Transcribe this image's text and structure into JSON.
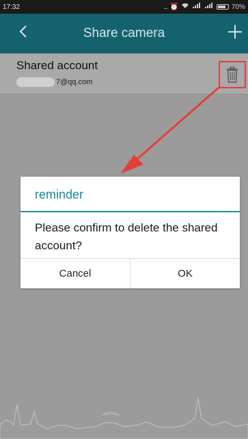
{
  "status_bar": {
    "time": "17:32",
    "signal_glyphs": "... ",
    "battery_percent": "70%"
  },
  "app_bar": {
    "back_icon": "chevron-left-icon",
    "title": "Share camera",
    "add_icon": "plus-icon"
  },
  "shared_list": {
    "row_label": "Shared account",
    "email_visible": "7@qq.com",
    "delete_icon": "trash-icon"
  },
  "dialog": {
    "title": "reminder",
    "message": "Please confirm to delete the shared account?",
    "cancel_label": "Cancel",
    "ok_label": "OK",
    "accent_color": "#14899a"
  },
  "colors": {
    "app_bar": "#14626e",
    "highlight": "#e2403a"
  }
}
